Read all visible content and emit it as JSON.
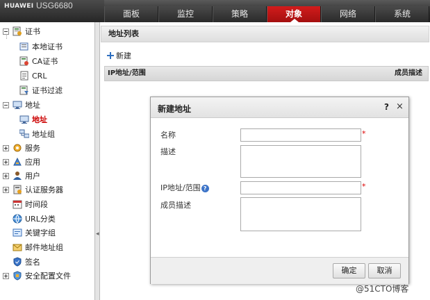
{
  "header": {
    "brand": "HUAWEI",
    "model": "USG6680",
    "tabs": [
      {
        "label": "面板"
      },
      {
        "label": "监控"
      },
      {
        "label": "策略"
      },
      {
        "label": "对象",
        "active": true
      },
      {
        "label": "网络"
      },
      {
        "label": "系统"
      }
    ],
    "accent_color": "#c81414"
  },
  "sidebar": {
    "items": [
      {
        "label": "证书",
        "icon": "certificate-icon",
        "expander": "minus"
      },
      {
        "label": "本地证书",
        "icon": "local-certificate-icon"
      },
      {
        "label": "CA证书",
        "icon": "ca-certificate-icon"
      },
      {
        "label": "CRL",
        "icon": "crl-icon"
      },
      {
        "label": "证书过滤",
        "icon": "certificate-filter-icon"
      },
      {
        "label": "地址",
        "icon": "address-icon",
        "expander": "minus"
      },
      {
        "label": "地址",
        "icon": "address-item-icon",
        "selected": true
      },
      {
        "label": "地址组",
        "icon": "address-group-icon"
      },
      {
        "label": "服务",
        "icon": "service-icon",
        "expander": "plus"
      },
      {
        "label": "应用",
        "icon": "application-icon",
        "expander": "plus"
      },
      {
        "label": "用户",
        "icon": "user-icon",
        "expander": "plus"
      },
      {
        "label": "认证服务器",
        "icon": "auth-server-icon",
        "expander": "plus"
      },
      {
        "label": "时间段",
        "icon": "time-range-icon"
      },
      {
        "label": "URL分类",
        "icon": "url-category-icon"
      },
      {
        "label": "关键字组",
        "icon": "keyword-group-icon"
      },
      {
        "label": "邮件地址组",
        "icon": "mail-address-group-icon"
      },
      {
        "label": "签名",
        "icon": "signature-icon"
      },
      {
        "label": "安全配置文件",
        "icon": "security-profile-icon",
        "expander": "plus"
      }
    ]
  },
  "main": {
    "title": "地址列表",
    "new_label": "新建",
    "columns": [
      "IP地址/范围",
      "成员描述"
    ]
  },
  "dialog": {
    "title": "新建地址",
    "help": "?",
    "close": "×",
    "fields": [
      {
        "label": "名称",
        "required": true,
        "value": ""
      },
      {
        "label": "描述",
        "required": false,
        "value": ""
      },
      {
        "label": "IP地址/范围",
        "required": true,
        "value": ""
      },
      {
        "label": "成员描述",
        "required": false,
        "value": ""
      }
    ],
    "required_mark": "*",
    "help_badge": "?",
    "ok_label": "确定",
    "cancel_label": "取消"
  },
  "watermark": "@51CTO博客"
}
